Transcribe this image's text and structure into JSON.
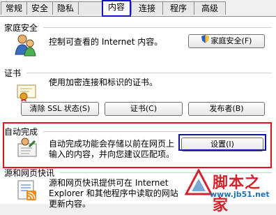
{
  "tabs": [
    {
      "label": "常规"
    },
    {
      "label": "安全"
    },
    {
      "label": "隐私"
    },
    {
      "label": "内容"
    },
    {
      "label": "连接"
    },
    {
      "label": "程序"
    },
    {
      "label": "高级"
    }
  ],
  "active_tab": "内容",
  "family_safety": {
    "title": "家庭安全",
    "description": "控制可查看的 Internet 内容。",
    "button": "家庭安全(F)",
    "icon": "family-users-icon"
  },
  "certificates": {
    "title": "证书",
    "description": "使用加密连接和标识的证书。",
    "clear_ssl_button": "清除 SSL 状态(S)",
    "certificates_button": "证书(C)",
    "publishers_button": "发布者(B)",
    "icon": "certificate-icon"
  },
  "autocomplete": {
    "title": "自动完成",
    "description_line1": "自动完成功能会存储以前在网页上",
    "description_line2": "输入的内容，并向您建议匹配项。",
    "settings_button": "设置(I)",
    "icon": "autocomplete-icon"
  },
  "feeds": {
    "title": "源和网页快讯",
    "description_line1": "源和网页快讯提供可在 Internet",
    "description_line2": "Explorer 和其他程序中读取的网站",
    "description_line3": "更新内容。",
    "icon": "feeds-icon"
  },
  "watermark": {
    "text": "脚本之家",
    "url": "www.jb51.net"
  },
  "colors": {
    "highlight_red": "#e1141e",
    "highlight_blue": "#141496"
  }
}
